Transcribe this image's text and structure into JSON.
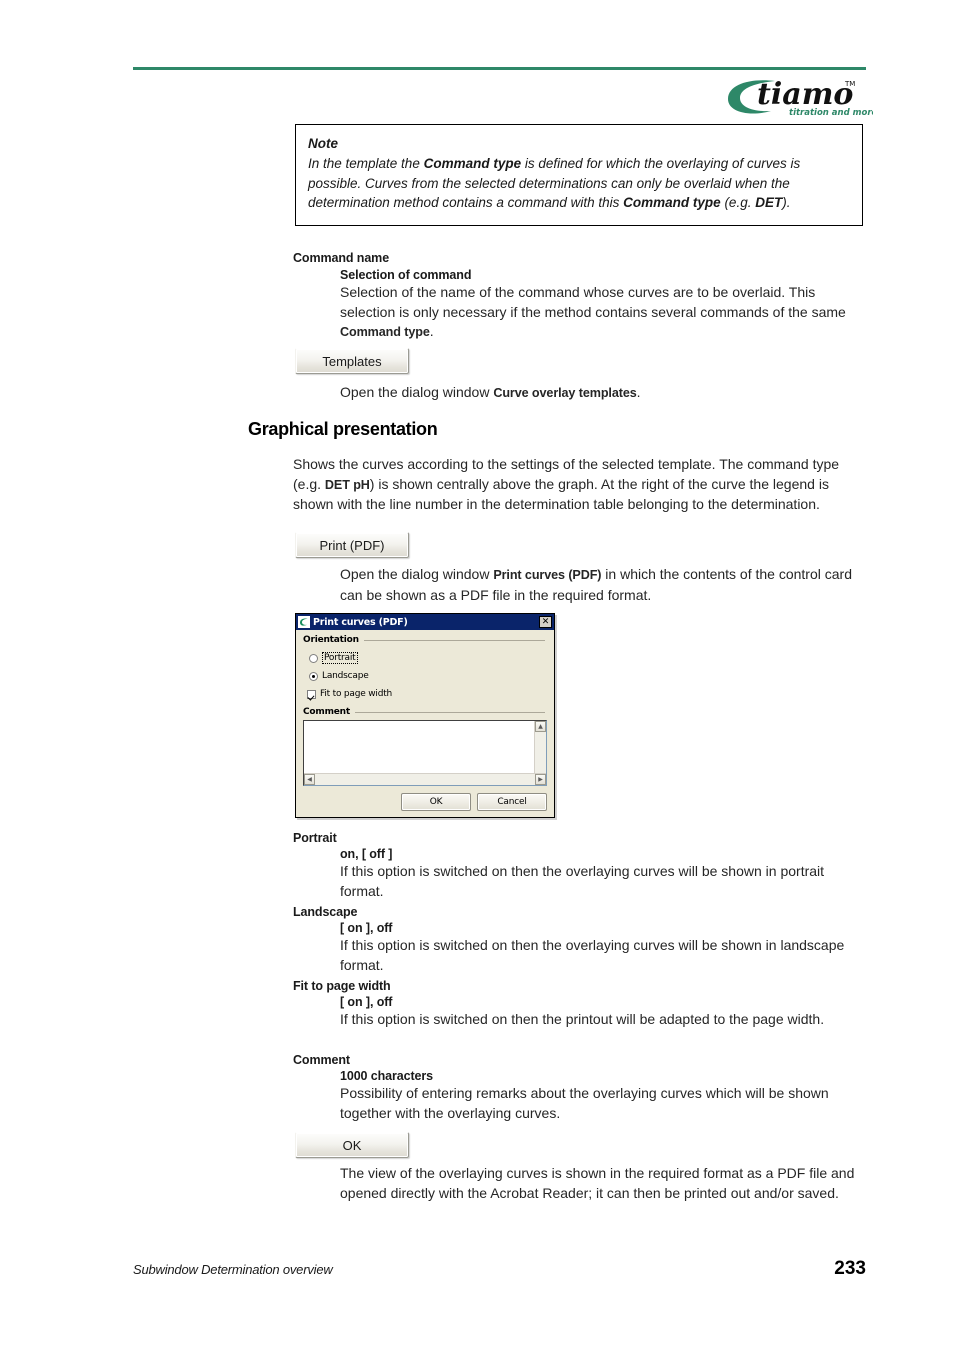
{
  "header": {
    "logo_wordmark": "tiamo",
    "logo_tm": "TM",
    "logo_tagline": "titration and more",
    "rule_color": "#2e8868"
  },
  "note": {
    "title": "Note",
    "line1_a": "In the template the ",
    "line1_b": "Command type",
    "line1_c": " is defined for which the overlaying of curves is possible. Curves from the selected determinations can only be overlaid when the determination method contains a command with this ",
    "line1_d": "Command type",
    "line1_e": " (e.g. ",
    "line1_f": "DET",
    "line1_g": ")."
  },
  "command_name": {
    "term": "Command name",
    "subterm": "Selection of command",
    "description_a": "Selection of the name of the command whose curves are to be overlaid. This selection is only necessary if the method contains several commands of the same ",
    "description_b": "Command type",
    "description_c": "."
  },
  "templates_button": {
    "label": "Templates",
    "description_a": "Open the dialog window ",
    "description_b": "Curve overlay templates",
    "description_c": "."
  },
  "graphical_presentation": {
    "heading": "Graphical presentation",
    "description_a": "Shows the curves according to the settings of the selected template. The command type (e.g. ",
    "description_b": "DET pH",
    "description_c": ") is shown centrally above the graph. At the right of the curve the legend is shown with the line number in the determination table belonging to the determination."
  },
  "print_button": {
    "label": "Print (PDF)",
    "description_a": "Open the dialog window ",
    "description_b": "Print curves (PDF)",
    "description_c": " in which the contents of the control card can be shown as a PDF file in the required format."
  },
  "dialog": {
    "title": "Print curves (PDF)",
    "close_label": "✕",
    "orientation_group": "Orientation",
    "portrait_label": "Portrait",
    "portrait_checked": false,
    "landscape_label": "Landscape",
    "landscape_checked": true,
    "fit_label": "Fit to page width",
    "fit_checked": true,
    "comment_group": "Comment",
    "comment_value": "",
    "ok_label": "OK",
    "cancel_label": "Cancel",
    "scroll_up": "▲",
    "scroll_down": "▼",
    "scroll_left": "◀",
    "scroll_right": "▶",
    "titlebar_color": "#0a246a",
    "face_color": "#ece9d8"
  },
  "portrait_entry": {
    "term": "Portrait",
    "values": "on, [ off ]",
    "description": "If this option is switched on then the overlaying curves will be shown in portrait format."
  },
  "landscape_entry": {
    "term": "Landscape",
    "values": "[ on ], off",
    "description": "If this option is switched on then the overlaying curves will be shown in landscape format."
  },
  "fit_entry": {
    "term": "Fit to page width",
    "values": "[ on ], off",
    "description": "If this option is switched on then the printout will be adapted to the page width."
  },
  "comment_entry": {
    "term": "Comment",
    "values": "1000 characters",
    "description": "Possibility of entering remarks about the overlaying curves which will be shown together with the overlaying curves."
  },
  "ok_button": {
    "label": "OK",
    "description": "The view of the overlaying curves is shown in the required format as a PDF file and opened directly with the Acrobat Reader; it can then be printed out and/or saved."
  },
  "footer": {
    "text": "Subwindow Determination overview",
    "page": "233"
  }
}
